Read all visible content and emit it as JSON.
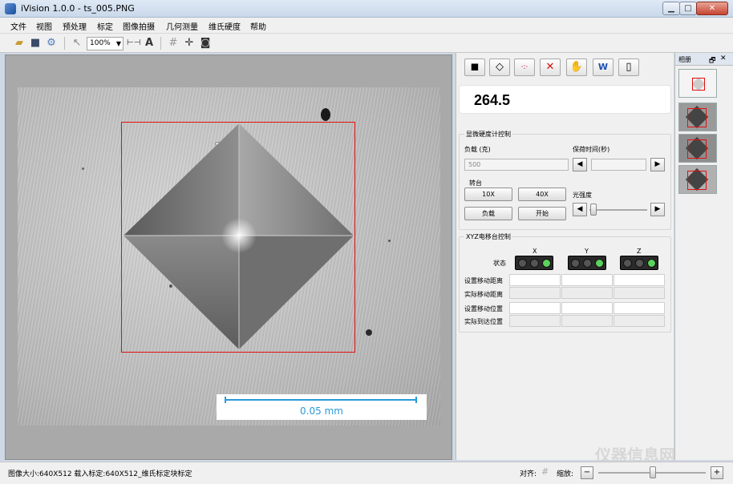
{
  "window": {
    "title": "iVision 1.0.0 - ts_005.PNG",
    "min_label": "▁",
    "max_label": "□",
    "close_label": "✕"
  },
  "menu": [
    "文件",
    "视图",
    "预处理",
    "标定",
    "图像拍摄",
    "几何测量",
    "维氏硬度",
    "帮助"
  ],
  "toolbar": {
    "zoom_value": "100%",
    "text_tool_label": "A"
  },
  "viewer": {
    "scale_label": "0.05 mm"
  },
  "panel": {
    "measurement_value": "264.5",
    "hardness_group_title": "显微硬度计控制",
    "load_label": "负载 (克)",
    "load_value": "500",
    "hold_time_label": "保荷时间(秒)",
    "turret_label": "转台",
    "btn_10x": "10X",
    "btn_40x": "40X",
    "btn_load": "负载",
    "btn_start": "开始",
    "light_label": "光强度",
    "xyz_group_title": "XYZ电移台控制",
    "axis_x": "X",
    "axis_y": "Y",
    "axis_z": "Z",
    "status_label": "状态",
    "row_labels": [
      "设置移动距离",
      "实际移动距离",
      "设置移动位置",
      "实际到达位置"
    ]
  },
  "album": {
    "title": "相册"
  },
  "status": {
    "image_info": "图像大小:640X512  载入标定:640X512_维氏标定块标定",
    "align_label": "对齐:",
    "zoom_label": "缩放:"
  },
  "watermark": "仪器信息网",
  "colors": {
    "measure_box": "#e01010",
    "scale_bar": "#2a9ad8",
    "status_light_on": "#5cd35c"
  }
}
